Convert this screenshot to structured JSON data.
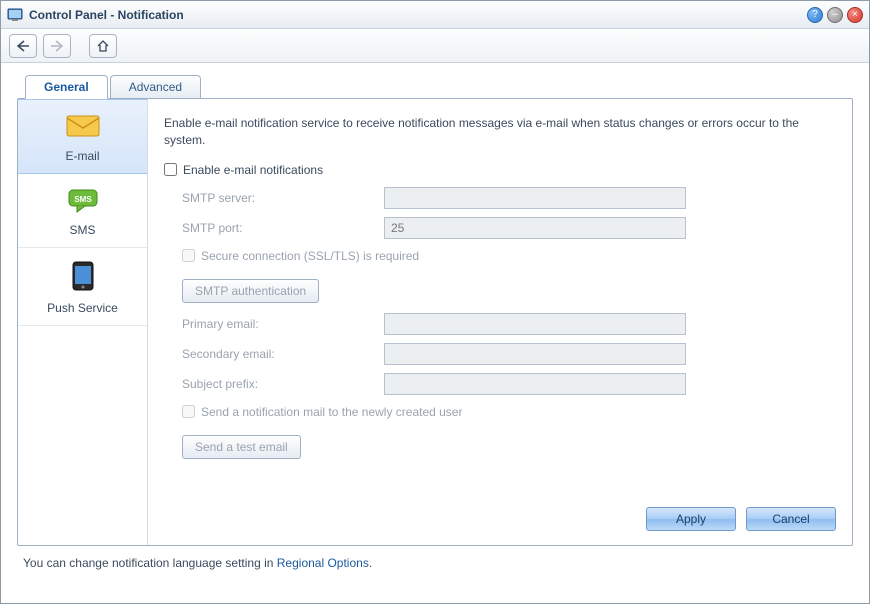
{
  "window": {
    "title": "Control Panel - Notification"
  },
  "tabs": [
    {
      "label": "General",
      "active": true
    },
    {
      "label": "Advanced",
      "active": false
    }
  ],
  "sidebar": {
    "items": [
      {
        "label": "E-mail",
        "icon": "email-icon",
        "active": true
      },
      {
        "label": "SMS",
        "icon": "sms-icon",
        "active": false
      },
      {
        "label": "Push Service",
        "icon": "push-icon",
        "active": false
      }
    ]
  },
  "main": {
    "description": "Enable e-mail notification service to receive notification messages via e-mail when status changes or errors occur to the system.",
    "enable_label": "Enable e-mail notifications",
    "enable_checked": false,
    "smtp_server_label": "SMTP server:",
    "smtp_server_value": "",
    "smtp_port_label": "SMTP port:",
    "smtp_port_value": "25",
    "ssl_label": "Secure connection (SSL/TLS) is required",
    "ssl_checked": false,
    "smtp_auth_btn": "SMTP authentication",
    "primary_email_label": "Primary email:",
    "primary_email_value": "",
    "secondary_email_label": "Secondary email:",
    "secondary_email_value": "",
    "subject_prefix_label": "Subject prefix:",
    "subject_prefix_value": "",
    "notify_new_user_label": "Send a notification mail to the newly created user",
    "notify_new_user_checked": false,
    "send_test_btn": "Send a test email",
    "apply_btn": "Apply",
    "cancel_btn": "Cancel"
  },
  "footnote": {
    "prefix": "You can change notification language setting in ",
    "link": "Regional Options",
    "suffix": "."
  }
}
